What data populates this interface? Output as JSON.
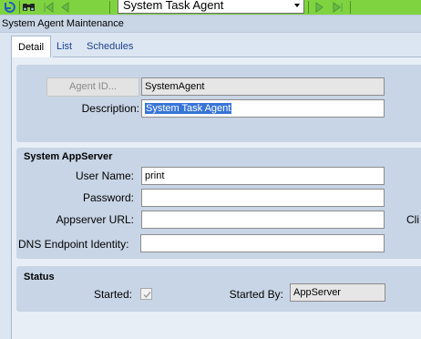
{
  "toolbar": {
    "agent_selector_value": "System Task Agent",
    "icons": [
      "refresh-icon",
      "find-icon",
      "first-record-icon",
      "previous-record-icon",
      "next-record-icon",
      "last-record-icon"
    ]
  },
  "window": {
    "title": "System Agent Maintenance"
  },
  "tabs": [
    {
      "label": "Detail",
      "active": true
    },
    {
      "label": "List",
      "active": false
    },
    {
      "label": "Schedules",
      "active": false
    }
  ],
  "agent": {
    "agent_id_button": "Agent ID...",
    "agent_id_value": "SystemAgent",
    "description_label": "Description:",
    "description_value": "System Task Agent"
  },
  "appserver": {
    "title": "System AppServer",
    "user_name_label": "User Name:",
    "user_name_value": "print",
    "password_label": "Password:",
    "password_value": "",
    "url_label": "Appserver URL:",
    "url_value": "",
    "dns_label": "DNS Endpoint Identity:",
    "dns_value": "",
    "cutoff_label": "Cli"
  },
  "status": {
    "title": "Status",
    "started_label": "Started:",
    "started_checked": true,
    "started_by_label": "Started By:",
    "started_by_value": "AppServer"
  },
  "colors": {
    "toolbar_bg": "#7fd340",
    "selection": "#3875d7",
    "group_bg": "#c8d5e6",
    "panel_bg": "#e8eef6"
  }
}
